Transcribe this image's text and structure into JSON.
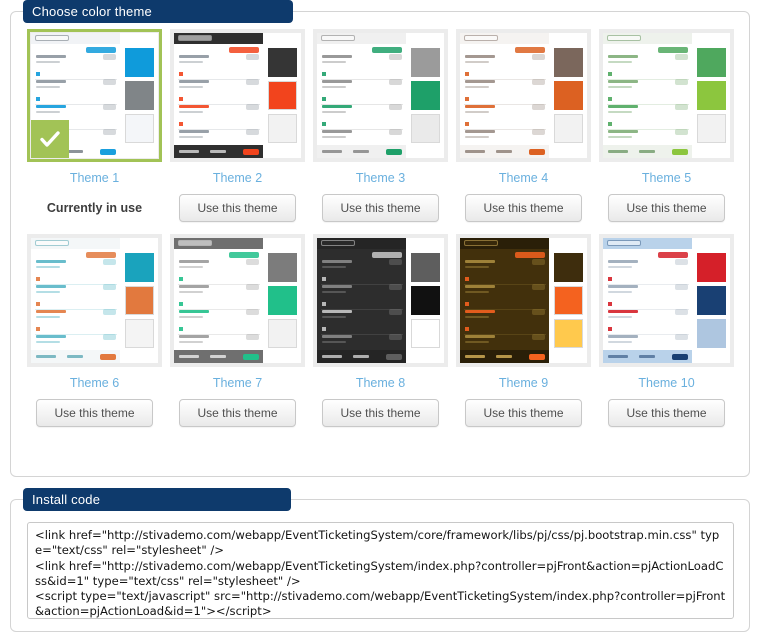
{
  "panels": {
    "themes": {
      "legend": "Choose color theme"
    },
    "install": {
      "legend": "Install code"
    }
  },
  "labels": {
    "use_theme": "Use this theme",
    "currently_in_use": "Currently in use"
  },
  "themes": [
    {
      "name": "Theme 1",
      "selected": true,
      "action": "Currently in use",
      "swatches": [
        "#0f9bdb",
        "#808588",
        "#f4f6f9"
      ],
      "mock": {
        "topbar": "#f1f3f6",
        "body": "#ffffff",
        "text": "#8d969e",
        "accent": "#0f9bdb",
        "bottombar": "#ffffff",
        "bottombar_btn": "#1a9fdd",
        "header_text": "#6f7880"
      }
    },
    {
      "name": "Theme 2",
      "selected": false,
      "action": "Use this theme",
      "swatches": [
        "#353535",
        "#f2441d",
        "#f2f2f2"
      ],
      "mock": {
        "topbar": "#2f2f2f",
        "body": "#ffffff",
        "text": "#8d969e",
        "accent": "#f2441d",
        "bottombar": "#2f2f2f",
        "bottombar_btn": "#f2441d",
        "header_text": "#dcdcdc"
      }
    },
    {
      "name": "Theme 3",
      "selected": false,
      "action": "Use this theme",
      "swatches": [
        "#9b9b9b",
        "#1ea069",
        "#eaeaea"
      ],
      "mock": {
        "topbar": "#f0f0f0",
        "body": "#ffffff",
        "text": "#8e8e8e",
        "accent": "#1ea069",
        "bottombar": "#f0f0f0",
        "bottombar_btn": "#1ea069",
        "header_text": "#808080"
      }
    },
    {
      "name": "Theme 4",
      "selected": false,
      "action": "Use this theme",
      "swatches": [
        "#7b675c",
        "#dc6122",
        "#f2f2f2"
      ],
      "mock": {
        "topbar": "#f5f3f1",
        "body": "#ffffff",
        "text": "#9a8d85",
        "accent": "#dc6122",
        "bottombar": "#f5f3f1",
        "bottombar_btn": "#dc6122",
        "header_text": "#8a7b72"
      }
    },
    {
      "name": "Theme 5",
      "selected": false,
      "action": "Use this theme",
      "swatches": [
        "#4fa85e",
        "#8cc63e",
        "#f2f2f2"
      ],
      "mock": {
        "topbar": "#eef2ec",
        "body": "#ffffff",
        "text": "#7fae78",
        "accent": "#4fa85e",
        "bottombar": "#eef2ec",
        "bottombar_btn": "#8cc63e",
        "header_text": "#6f9a69"
      }
    },
    {
      "name": "Theme 6",
      "selected": false,
      "action": "Use this theme",
      "swatches": [
        "#1aa3bd",
        "#e2793e",
        "#f4f4f4"
      ],
      "mock": {
        "topbar": "#f4f7f8",
        "body": "#ffffff",
        "text": "#59b6c6",
        "accent": "#e2793e",
        "bottombar": "#f4f7f8",
        "bottombar_btn": "#e2793e",
        "header_text": "#5fa9b5"
      }
    },
    {
      "name": "Theme 7",
      "selected": false,
      "action": "Use this theme",
      "swatches": [
        "#7c7c7c",
        "#21c08a",
        "#f2f2f2"
      ],
      "mock": {
        "topbar": "#6f6f6f",
        "body": "#ffffff",
        "text": "#9a9a9a",
        "accent": "#21c08a",
        "bottombar": "#6f6f6f",
        "bottombar_btn": "#21c08a",
        "header_text": "#ececec"
      }
    },
    {
      "name": "Theme 8",
      "selected": false,
      "action": "Use this theme",
      "swatches": [
        "#5e5e5e",
        "#111111",
        "#ffffff"
      ],
      "mock": {
        "topbar": "#252525",
        "body": "#2d2d2d",
        "text": "#8a8a8a",
        "accent": "#c8c8c8",
        "bottombar": "#252525",
        "bottombar_btn": "#5e5e5e",
        "header_text": "#d0d0d0"
      }
    },
    {
      "name": "Theme 9",
      "selected": false,
      "action": "Use this theme",
      "swatches": [
        "#3e2d0d",
        "#f4621f",
        "#ffc94d"
      ],
      "mock": {
        "topbar": "#2a1f08",
        "body": "#42300c",
        "text": "#a98b3d",
        "accent": "#f4621f",
        "bottombar": "#2a1f08",
        "bottombar_btn": "#f4621f",
        "header_text": "#d8b35a"
      }
    },
    {
      "name": "Theme 10",
      "selected": false,
      "action": "Use this theme",
      "swatches": [
        "#d52029",
        "#194073",
        "#aec6e0"
      ],
      "mock": {
        "topbar": "#b9d2ea",
        "body": "#ffffff",
        "text": "#9aa8b8",
        "accent": "#d52029",
        "bottombar": "#b9d2ea",
        "bottombar_btn": "#194073",
        "header_text": "#4a6c93"
      }
    }
  ],
  "install": {
    "code": "<link href=\"http://stivademo.com/webapp/EventTicketingSystem/core/framework/libs/pj/css/pj.bootstrap.min.css\" type=\"text/css\" rel=\"stylesheet\" />\n<link href=\"http://stivademo.com/webapp/EventTicketingSystem/index.php?controller=pjFront&action=pjActionLoadCss&id=1\" type=\"text/css\" rel=\"stylesheet\" />\n<script type=\"text/javascript\" src=\"http://stivademo.com/webapp/EventTicketingSystem/index.php?controller=pjFront&action=pjActionLoad&id=1\"></script>"
  }
}
